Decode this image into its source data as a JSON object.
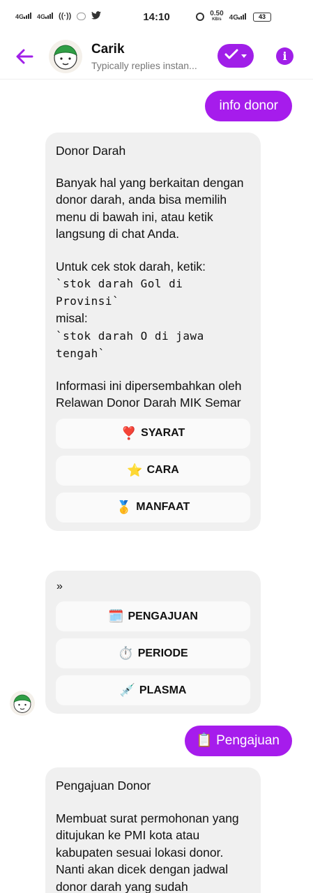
{
  "status_bar": {
    "network_left": [
      "4G",
      "4G"
    ],
    "time": "14:10",
    "speed": "0.50",
    "speed_unit": "KB/s",
    "network_right": "4G",
    "battery": "43"
  },
  "header": {
    "title": "Carik",
    "subtitle": "Typically replies instan...",
    "accent_color": "#a01fe8"
  },
  "messages": {
    "user1": "info donor",
    "card1": {
      "heading": "Donor Darah",
      "para1": "Banyak hal yang berkaitan dengan donor darah, anda bisa memilih menu di bawah ini, atau ketik langsung di chat Anda.",
      "para2_intro": "Untuk cek stok darah, ketik:",
      "code1": "`stok darah Gol di Provinsi`",
      "example_label": "misal:",
      "code2": "`stok darah O di jawa tengah`",
      "para3": "Informasi ini dipersembahkan oleh Relawan Donor Darah MIK Semar",
      "buttons": [
        {
          "emoji": "❣️",
          "label": "SYARAT"
        },
        {
          "emoji": "⭐",
          "label": "CARA"
        },
        {
          "emoji": "🥇",
          "label": "MANFAAT"
        }
      ]
    },
    "card2": {
      "separator": "»",
      "buttons": [
        {
          "emoji": "🗓️",
          "label": "PENGAJUAN"
        },
        {
          "emoji": "⏱️",
          "label": "PERIODE"
        },
        {
          "emoji": "💉",
          "label": "PLASMA"
        }
      ]
    },
    "user2": {
      "emoji": "📋",
      "label": "Pengajuan"
    },
    "card3": {
      "heading": "Pengajuan Donor",
      "body": "Membuat surat permohonan yang ditujukan ke PMI kota atau kabupaten sesuai lokasi donor. Nanti akan dicek dengan jadwal donor darah yang sudah"
    }
  }
}
